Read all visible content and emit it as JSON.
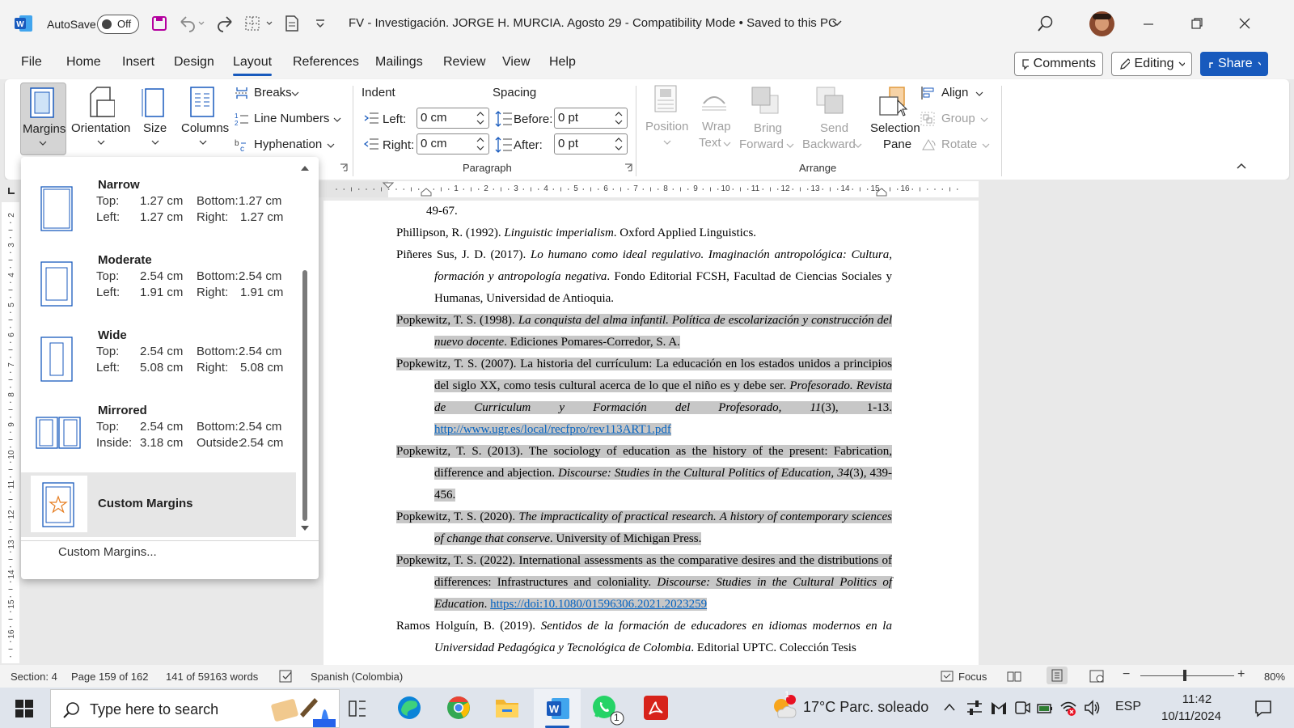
{
  "titlebar": {
    "autosave_label": "AutoSave",
    "autosave_state": "Off",
    "document_title": "FV - Investigación. JORGE H. MURCIA. Agosto 29  -  Compatibility Mode • Saved to this PC"
  },
  "tabs": [
    {
      "label": "File"
    },
    {
      "label": "Home"
    },
    {
      "label": "Insert"
    },
    {
      "label": "Design"
    },
    {
      "label": "Layout"
    },
    {
      "label": "References"
    },
    {
      "label": "Mailings"
    },
    {
      "label": "Review"
    },
    {
      "label": "View"
    },
    {
      "label": "Help"
    }
  ],
  "top_actions": {
    "comments": "Comments",
    "editing": "Editing",
    "share": "Share"
  },
  "ribbon": {
    "margins": "Margins",
    "orientation": "Orientation",
    "size": "Size",
    "columns": "Columns",
    "breaks": "Breaks",
    "line_numbers": "Line Numbers",
    "hyphenation": "Hyphenation",
    "indent_title": "Indent",
    "spacing_title": "Spacing",
    "indent_left_label": "Left:",
    "indent_left_value": "0 cm",
    "indent_right_label": "Right:",
    "indent_right_value": "0 cm",
    "spacing_before_label": "Before:",
    "spacing_before_value": "0 pt",
    "spacing_after_label": "After:",
    "spacing_after_value": "0 pt",
    "paragraph_group": "Paragraph",
    "position": "Position",
    "wrap_text_1": "Wrap",
    "wrap_text_2": "Text",
    "bring_forward_1": "Bring",
    "bring_forward_2": "Forward",
    "send_backward_1": "Send",
    "send_backward_2": "Backward",
    "selection_pane_1": "Selection",
    "selection_pane_2": "Pane",
    "align": "Align",
    "group": "Group",
    "rotate": "Rotate",
    "arrange_group": "Arrange"
  },
  "ruler": {
    "numbers": [
      "1",
      "2",
      "3",
      "4",
      "5",
      "6",
      "7",
      "8",
      "9",
      "10",
      "11",
      "12",
      "13",
      "14",
      "15",
      "16"
    ],
    "vnumbers": [
      "2",
      "3",
      "4",
      "5",
      "6",
      "7",
      "8",
      "9",
      "10",
      "11",
      "12",
      "13",
      "14",
      "15",
      "16"
    ]
  },
  "margins_menu": {
    "items": [
      {
        "name": "Narrow",
        "l1a": "Top:",
        "l1b": "1.27 cm",
        "l1c": "Bottom:",
        "l1d": "1.27 cm",
        "l2a": "Left:",
        "l2b": "1.27 cm",
        "l2c": "Right:",
        "l2d": "1.27 cm"
      },
      {
        "name": "Moderate",
        "l1a": "Top:",
        "l1b": "2.54 cm",
        "l1c": "Bottom:",
        "l1d": "2.54 cm",
        "l2a": "Left:",
        "l2b": "1.91 cm",
        "l2c": "Right:",
        "l2d": "1.91 cm"
      },
      {
        "name": "Wide",
        "l1a": "Top:",
        "l1b": "2.54 cm",
        "l1c": "Bottom:",
        "l1d": "2.54 cm",
        "l2a": "Left:",
        "l2b": "5.08 cm",
        "l2c": "Right:",
        "l2d": "5.08 cm"
      },
      {
        "name": "Mirrored",
        "l1a": "Top:",
        "l1b": "2.54 cm",
        "l1c": "Bottom:",
        "l1d": "2.54 cm",
        "l2a": "Inside:",
        "l2b": "3.18 cm",
        "l2c": "Outside:",
        "l2d": "2.54 cm"
      }
    ],
    "custom_item": "Custom Margins",
    "custom_link": "Custom Margins..."
  },
  "document": {
    "r0": "49-67.",
    "r1a": "Phillipson, R. (1992). ",
    "r1b": "Linguistic imperialism",
    "r1c": ". Oxford Applied Linguistics.",
    "r2a": "Piñeres Sus, J. D. (2017). ",
    "r2b": "Lo humano como ideal regulativo. Imaginación antropológica: Cultura, formación y antropología negativa",
    "r2c": ". Fondo Editorial FCSH, Facultad de Ciencias Sociales y Humanas, Universidad de Antioquia.",
    "r3a": "Popkewitz, T. S. (1998). ",
    "r3b": "La conquista del alma infantil. Política de escolarización y construcción del nuevo docente",
    "r3c": ". Ediciones Pomares-Corredor, S. A.",
    "r4a": "Popkewitz, T. S. (2007). La historia del currículum: La educación en los estados unidos a principios del siglo XX, como tesis cultural acerca de lo que el niño es y debe ser. ",
    "r4b": "Profesorado. Revista de Curriculum y Formación del Profesorado, 11",
    "r4c": "(3), 1-13. ",
    "r4d": "http://www.ugr.es/local/recfpro/rev113ART1.pdf",
    "r5a": "Popkewitz, T. S. (2013). The sociology of education as the history of the present: Fabrication, difference and abjection. ",
    "r5b": "Discourse: Studies in the Cultural Politics of Education, 34",
    "r5c": "(3), 439-456.",
    "r6a": "Popkewitz, T. S. (2020). ",
    "r6b": "The impracticality of practical research. A history of contemporary sciences of change that conserve",
    "r6c": ". University of Michigan Press.",
    "r7a": "Popkewitz, T. S. (2022). International assessments as the comparative desires and the distributions of differences: Infrastructures and coloniality. ",
    "r7b": "Discourse: Studies in the Cultural Politics of Education",
    "r7c": ". ",
    "r7d": "https://doi:10.1080/01596306.2021.2023259",
    "r8a": "Ramos Holguín, B. (2019). ",
    "r8b": "Sentidos de la formación de educadores en idiomas modernos en la Universidad Pedagógica y Tecnológica de Colombia",
    "r8c": ". Editorial UPTC. Colección Tesis"
  },
  "status": {
    "section": "Section: 4",
    "page": "Page 159 of 162",
    "words": "141 of 59163 words",
    "language": "Spanish (Colombia)",
    "focus": "Focus",
    "zoom": "80%"
  },
  "taskbar": {
    "search_placeholder": "Type here to search",
    "weather": "17°C  Parc. soleado",
    "lang": "ESP",
    "time": "11:42",
    "date": "10/11/2024",
    "notification_count": "1",
    "whatsapp_count": "1"
  },
  "colors": {
    "accent": "#185abd",
    "highlight": "#c7c7c7",
    "link": "#0563c1"
  }
}
